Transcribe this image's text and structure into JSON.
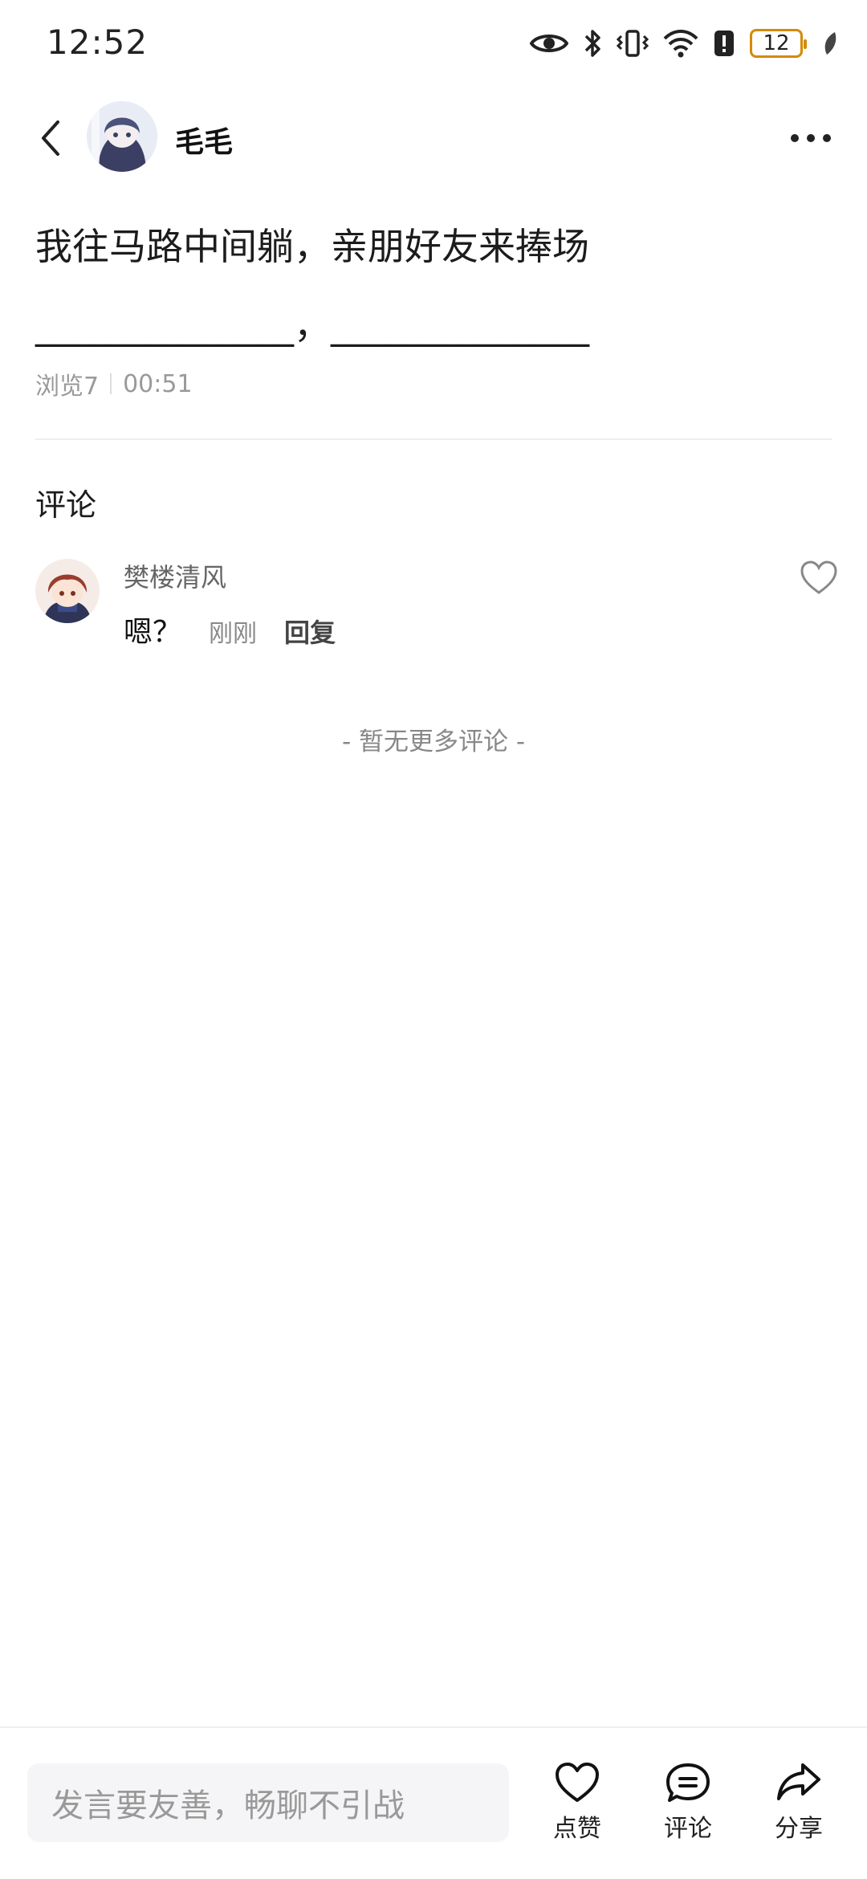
{
  "status_bar": {
    "time": "12:52",
    "battery_level": "12",
    "battery_color": "#d58a00",
    "icons": [
      "eye-icon",
      "bluetooth-icon",
      "vibrate-icon",
      "wifi-icon",
      "alert-icon",
      "battery-icon",
      "leaf-icon"
    ]
  },
  "header": {
    "user_name": "毛毛",
    "back_icon": "chevron-left-icon",
    "more_icon": "more-horizontal-icon"
  },
  "post": {
    "text": "我往马路中间躺，亲朋好友来捧场\n______________，______________",
    "views": "浏览7",
    "time": "00:51"
  },
  "comments": {
    "title": "评论",
    "items": [
      {
        "author": "樊楼清风",
        "text": "嗯？",
        "time": "刚刚",
        "reply_label": "回复"
      }
    ],
    "no_more": "- 暂无更多评论 -"
  },
  "bottom_bar": {
    "input_placeholder": "发言要友善，畅聊不引战",
    "like_label": "点赞",
    "comment_label": "评论",
    "share_label": "分享"
  }
}
